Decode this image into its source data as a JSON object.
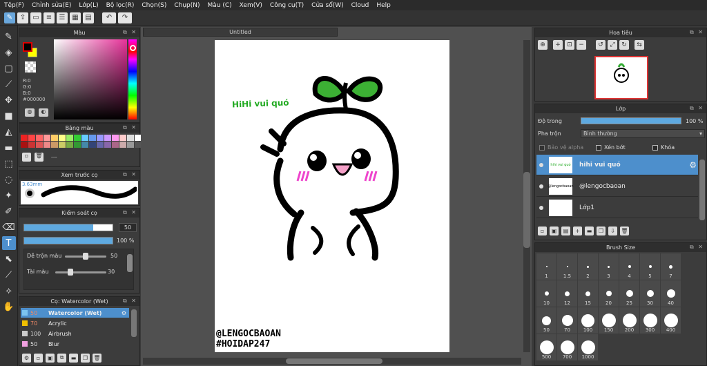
{
  "menu": [
    "Tệp(F)",
    "Chỉnh sửa(E)",
    "Lớp(L)",
    "Bộ lọc(R)",
    "Chọn(S)",
    "Chụp(N)",
    "Màu (C)",
    "Xem(V)",
    "Công cụ(T)",
    "Cửa sổ(W)",
    "Cloud",
    "Help"
  ],
  "color_panel": {
    "title": "Màu",
    "r": "R:0",
    "g": "G:0",
    "b": "B:0",
    "hex": "#000000",
    "accent": "#e8329a"
  },
  "palette_panel": {
    "title": "Bảng màu",
    "extra": "---"
  },
  "palette_colors": [
    "#e22",
    "#f44",
    "#f66",
    "#f99",
    "#fc6",
    "#ff8",
    "#9e6",
    "#3c3",
    "#6cf",
    "#69e",
    "#99f",
    "#c9f",
    "#f9e",
    "#fcc",
    "#ddd",
    "#fff",
    "#a11",
    "#c33",
    "#d55",
    "#e88",
    "#c96",
    "#cc6",
    "#7a4",
    "#393",
    "#48a",
    "#347",
    "#66a",
    "#86a",
    "#a68",
    "#caa",
    "#999",
    "#555"
  ],
  "brush_preview": {
    "title": "Xem trước cọ",
    "size": "3.63mm"
  },
  "brush_control": {
    "title": "Kiểm soát cọ",
    "size_value": "50",
    "opacity_value": "100 %",
    "blend_label": "Dễ trộn màu",
    "blend_value": "50",
    "amount_label": "Tài màu",
    "amount_value": "30",
    "size_fraction": 0.78,
    "opacity_fraction": 1.0
  },
  "brush_list": {
    "title": "Cọ: Watercolor (Wet)",
    "items": [
      {
        "num": "50",
        "name": "Watercolor (Wet)",
        "color": "#7cc4f0",
        "selected": true
      },
      {
        "num": "70",
        "name": "Acrylic",
        "color": "#f0c000",
        "selected": false
      },
      {
        "num": "100",
        "name": "Airbrush",
        "color": "#cccccc",
        "selected": false
      },
      {
        "num": "50",
        "name": "Blur",
        "color": "#f0a0e0",
        "selected": false
      }
    ]
  },
  "canvas": {
    "tab": "Untitled",
    "text1": "HiHi vui quó",
    "text2a": "@LENGOCBAOAN",
    "text2b": "#HOIDAP247"
  },
  "nav_panel": {
    "title": "Hoa tiêu"
  },
  "layer_panel": {
    "title": "Lớp",
    "opacity_label": "Độ trong",
    "opacity_value": "100 %",
    "blend_label": "Pha trộn",
    "blend_value": "Bình thường",
    "protect_alpha": "Bảo vệ alpha",
    "clipping": "Xén bớt",
    "lock": "Khóa",
    "layers": [
      {
        "name": "hihi vui quó",
        "thumb": "hihi vui quó",
        "selected": true
      },
      {
        "name": "@lengocbaoan",
        "thumb": "@lengocbaoan",
        "selected": false
      },
      {
        "name": "Lớp1",
        "thumb": "",
        "selected": false
      }
    ]
  },
  "brush_size": {
    "title": "Brush Size",
    "sizes": [
      "1",
      "1.5",
      "2",
      "3",
      "4",
      "5",
      "7",
      "10",
      "12",
      "15",
      "20",
      "25",
      "30",
      "40",
      "50",
      "70",
      "100",
      "150",
      "200",
      "300",
      "400",
      "500",
      "700",
      "1000"
    ]
  }
}
